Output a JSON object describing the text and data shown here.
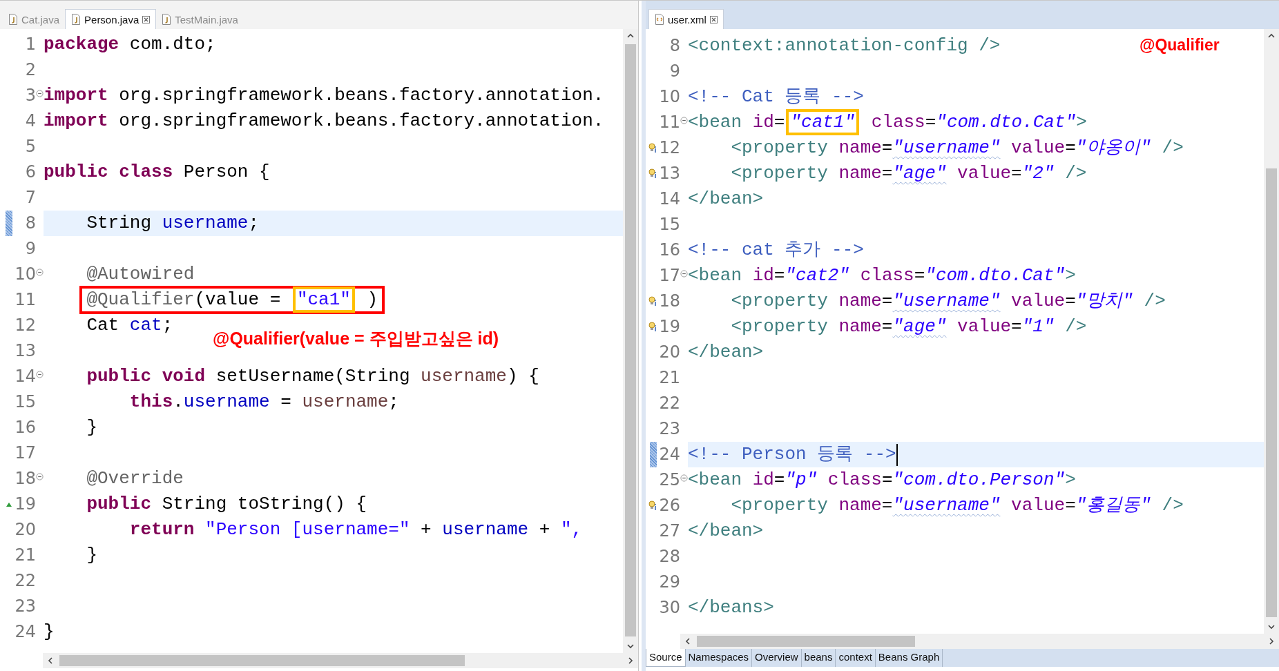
{
  "left_editor": {
    "tabs": [
      {
        "label": "Cat.java",
        "selected": false
      },
      {
        "label": "Person.java",
        "selected": true
      },
      {
        "label": "TestMain.java",
        "selected": false
      }
    ],
    "lines": [
      {
        "number": "1",
        "current": false,
        "tokens": [
          {
            "kind": "kw",
            "text": "package "
          },
          {
            "kind": "pl",
            "text": "com.dto;"
          }
        ]
      },
      {
        "number": "2",
        "current": false
      },
      {
        "number": "3",
        "current": false,
        "kind": "fold",
        "tokens": [
          {
            "kind": "kw",
            "text": "import "
          },
          {
            "kind": "pl",
            "text": "org.springframework.beans.factory.annotation."
          }
        ]
      },
      {
        "number": "4",
        "current": false,
        "tokens": [
          {
            "kind": "kw",
            "text": "import "
          },
          {
            "kind": "pl",
            "text": "org.springframework.beans.factory.annotation."
          }
        ]
      },
      {
        "number": "5",
        "current": false
      },
      {
        "number": "6",
        "current": false,
        "tokens": [
          {
            "kind": "kw",
            "text": "public class "
          },
          {
            "kind": "pl",
            "text": "Person {"
          }
        ]
      },
      {
        "number": "7",
        "current": false
      },
      {
        "number": "8",
        "current": true,
        "tokens": [
          {
            "kind": "pl",
            "text": "    String "
          },
          {
            "kind": "fld",
            "text": "username"
          },
          {
            "kind": "pl",
            "text": ";"
          }
        ]
      },
      {
        "number": "9",
        "current": false
      },
      {
        "number": "10",
        "current": false,
        "kind": "fold",
        "tokens": [
          {
            "kind": "ann",
            "text": "    @Autowired"
          }
        ]
      },
      {
        "number": "11",
        "current": false,
        "tokens": [
          {
            "kind": "frame",
            "tokens": [
              {
                "kind": "ann",
                "text": "@Qualifier"
              },
              {
                "kind": "pl",
                "text": "(value = "
              },
              {
                "kind": "highlight",
                "tokens": [
                  {
                    "kind": "str",
                    "text": "\"ca1\""
                  }
                ]
              },
              {
                "kind": "pl",
                "text": " )"
              }
            ]
          }
        ]
      },
      {
        "number": "12",
        "current": false,
        "tokens": [
          {
            "kind": "pl",
            "text": "    Cat "
          },
          {
            "kind": "fld",
            "text": "cat"
          },
          {
            "kind": "pl",
            "text": ";"
          }
        ]
      },
      {
        "number": "13",
        "current": false
      },
      {
        "number": "14",
        "current": false,
        "kind": "fold",
        "tokens": [
          {
            "kind": "kw",
            "text": "    public void "
          },
          {
            "kind": "pl",
            "text": "setUsername(String "
          },
          {
            "kind": "par",
            "text": "username"
          },
          {
            "kind": "pl",
            "text": ") {"
          }
        ]
      },
      {
        "number": "15",
        "current": false,
        "tokens": [
          {
            "kind": "kw",
            "text": "        this"
          },
          {
            "kind": "pl",
            "text": "."
          },
          {
            "kind": "fld",
            "text": "username"
          },
          {
            "kind": "pl",
            "text": " = "
          },
          {
            "kind": "par",
            "text": "username"
          },
          {
            "kind": "pl",
            "text": ";"
          }
        ]
      },
      {
        "number": "16",
        "current": false,
        "tokens": [
          {
            "kind": "pl",
            "text": "    }"
          }
        ]
      },
      {
        "number": "17",
        "current": false
      },
      {
        "number": "18",
        "current": false,
        "kind": "fold",
        "tokens": [
          {
            "kind": "ann",
            "text": "    @Override"
          }
        ]
      },
      {
        "number": "19",
        "current": false,
        "kind": "override",
        "tokens": [
          {
            "kind": "kw",
            "text": "    public "
          },
          {
            "kind": "pl",
            "text": "String toString() {"
          }
        ]
      },
      {
        "number": "20",
        "current": false,
        "tokens": [
          {
            "kind": "kw",
            "text": "        return "
          },
          {
            "kind": "str",
            "text": "\"Person [username=\""
          },
          {
            "kind": "pl",
            "text": " + "
          },
          {
            "kind": "fld",
            "text": "username"
          },
          {
            "kind": "pl",
            "text": " + "
          },
          {
            "kind": "str",
            "text": "\","
          }
        ]
      },
      {
        "number": "21",
        "current": false,
        "tokens": [
          {
            "kind": "pl",
            "text": "    }"
          }
        ]
      },
      {
        "number": "22",
        "current": false
      },
      {
        "number": "23",
        "current": false
      },
      {
        "number": "24",
        "current": false,
        "tokens": [
          {
            "kind": "pl",
            "text": "}"
          }
        ]
      }
    ],
    "note": "@Qualifier(value = 주입받고싶은 id)"
  },
  "right_editor": {
    "tabs": [
      {
        "label": "user.xml",
        "selected": true
      }
    ],
    "note": "@Qualifier",
    "lines": [
      {
        "number": "8",
        "current": false,
        "tokens": [
          {
            "kind": "tag",
            "text": "<context:annotation-config />"
          }
        ]
      },
      {
        "number": "9",
        "current": false
      },
      {
        "number": "10",
        "current": false,
        "tokens": [
          {
            "kind": "cmt",
            "text": "<!-- Cat 등록 -->"
          }
        ]
      },
      {
        "number": "11",
        "current": false,
        "kind": "fold",
        "tokens": [
          {
            "kind": "tag",
            "text": "<bean "
          },
          {
            "kind": "attr",
            "text": "id"
          },
          {
            "kind": "pl",
            "text": "="
          },
          {
            "kind": "highlight",
            "tokens": [
              {
                "kind": "val",
                "text": "\"cat1\""
              }
            ]
          },
          {
            "kind": "attr",
            "text": " class"
          },
          {
            "kind": "pl",
            "text": "="
          },
          {
            "kind": "val",
            "text": "\"com.dto.Cat\""
          },
          {
            "kind": "tag",
            "text": ">"
          }
        ]
      },
      {
        "number": "12",
        "current": false,
        "kind": "bulb",
        "tokens": [
          {
            "kind": "tag",
            "text": "    <property "
          },
          {
            "kind": "attr",
            "text": "name"
          },
          {
            "kind": "pl",
            "text": "="
          },
          {
            "kind": "valw",
            "text": "\"username\""
          },
          {
            "kind": "attr",
            "text": " value"
          },
          {
            "kind": "pl",
            "text": "="
          },
          {
            "kind": "val",
            "text": "\"야옹이\""
          },
          {
            "kind": "tag",
            "text": " />"
          }
        ]
      },
      {
        "number": "13",
        "current": false,
        "kind": "bulb",
        "tokens": [
          {
            "kind": "tag",
            "text": "    <property "
          },
          {
            "kind": "attr",
            "text": "name"
          },
          {
            "kind": "pl",
            "text": "="
          },
          {
            "kind": "valw",
            "text": "\"age\""
          },
          {
            "kind": "attr",
            "text": " value"
          },
          {
            "kind": "pl",
            "text": "="
          },
          {
            "kind": "val",
            "text": "\"2\""
          },
          {
            "kind": "tag",
            "text": " />"
          }
        ]
      },
      {
        "number": "14",
        "current": false,
        "tokens": [
          {
            "kind": "tag",
            "text": "</bean>"
          }
        ]
      },
      {
        "number": "15",
        "current": false
      },
      {
        "number": "16",
        "current": false,
        "tokens": [
          {
            "kind": "cmt",
            "text": "<!-- cat 추가 -->"
          }
        ]
      },
      {
        "number": "17",
        "current": false,
        "kind": "fold",
        "tokens": [
          {
            "kind": "tag",
            "text": "<bean "
          },
          {
            "kind": "attr",
            "text": "id"
          },
          {
            "kind": "pl",
            "text": "="
          },
          {
            "kind": "val",
            "text": "\"cat2\""
          },
          {
            "kind": "attr",
            "text": " class"
          },
          {
            "kind": "pl",
            "text": "="
          },
          {
            "kind": "val",
            "text": "\"com.dto.Cat\""
          },
          {
            "kind": "tag",
            "text": ">"
          }
        ]
      },
      {
        "number": "18",
        "current": false,
        "kind": "bulb",
        "tokens": [
          {
            "kind": "tag",
            "text": "    <property "
          },
          {
            "kind": "attr",
            "text": "name"
          },
          {
            "kind": "pl",
            "text": "="
          },
          {
            "kind": "valw",
            "text": "\"username\""
          },
          {
            "kind": "attr",
            "text": " value"
          },
          {
            "kind": "pl",
            "text": "="
          },
          {
            "kind": "val",
            "text": "\"망치\""
          },
          {
            "kind": "tag",
            "text": " />"
          }
        ]
      },
      {
        "number": "19",
        "current": false,
        "kind": "bulb",
        "tokens": [
          {
            "kind": "tag",
            "text": "    <property "
          },
          {
            "kind": "attr",
            "text": "name"
          },
          {
            "kind": "pl",
            "text": "="
          },
          {
            "kind": "valw",
            "text": "\"age\""
          },
          {
            "kind": "attr",
            "text": " value"
          },
          {
            "kind": "pl",
            "text": "="
          },
          {
            "kind": "val",
            "text": "\"1\""
          },
          {
            "kind": "tag",
            "text": " />"
          }
        ]
      },
      {
        "number": "20",
        "current": false,
        "tokens": [
          {
            "kind": "tag",
            "text": "</bean>"
          }
        ]
      },
      {
        "number": "21",
        "current": false
      },
      {
        "number": "22",
        "current": false
      },
      {
        "number": "23",
        "current": false
      },
      {
        "number": "24",
        "current": true,
        "caret": true,
        "tokens": [
          {
            "kind": "cmt",
            "text": "<!-- Person 등록 -->"
          }
        ]
      },
      {
        "number": "25",
        "current": false,
        "kind": "fold",
        "tokens": [
          {
            "kind": "tag",
            "text": "<bean "
          },
          {
            "kind": "attr",
            "text": "id"
          },
          {
            "kind": "pl",
            "text": "="
          },
          {
            "kind": "val",
            "text": "\"p\""
          },
          {
            "kind": "attr",
            "text": " class"
          },
          {
            "kind": "pl",
            "text": "="
          },
          {
            "kind": "val",
            "text": "\"com.dto.Person\""
          },
          {
            "kind": "tag",
            "text": ">"
          }
        ]
      },
      {
        "number": "26",
        "current": false,
        "kind": "bulb",
        "tokens": [
          {
            "kind": "tag",
            "text": "    <property "
          },
          {
            "kind": "attr",
            "text": "name"
          },
          {
            "kind": "pl",
            "text": "="
          },
          {
            "kind": "valw",
            "text": "\"username\""
          },
          {
            "kind": "attr",
            "text": " value"
          },
          {
            "kind": "pl",
            "text": "="
          },
          {
            "kind": "val",
            "text": "\"홍길동\""
          },
          {
            "kind": "tag",
            "text": " />"
          }
        ]
      },
      {
        "number": "27",
        "current": false,
        "tokens": [
          {
            "kind": "tag",
            "text": "</bean>"
          }
        ]
      },
      {
        "number": "28",
        "current": false
      },
      {
        "number": "29",
        "current": false
      },
      {
        "number": "30",
        "current": false,
        "tokens": [
          {
            "kind": "tag",
            "text": "</beans>"
          }
        ]
      }
    ],
    "bottom_tabs": [
      {
        "label": "Source",
        "selected": true
      },
      {
        "label": "Namespaces",
        "selected": false
      },
      {
        "label": "Overview",
        "selected": false
      },
      {
        "label": "beans",
        "selected": false
      },
      {
        "label": "context",
        "selected": false
      },
      {
        "label": "Beans Graph",
        "selected": false
      }
    ]
  }
}
